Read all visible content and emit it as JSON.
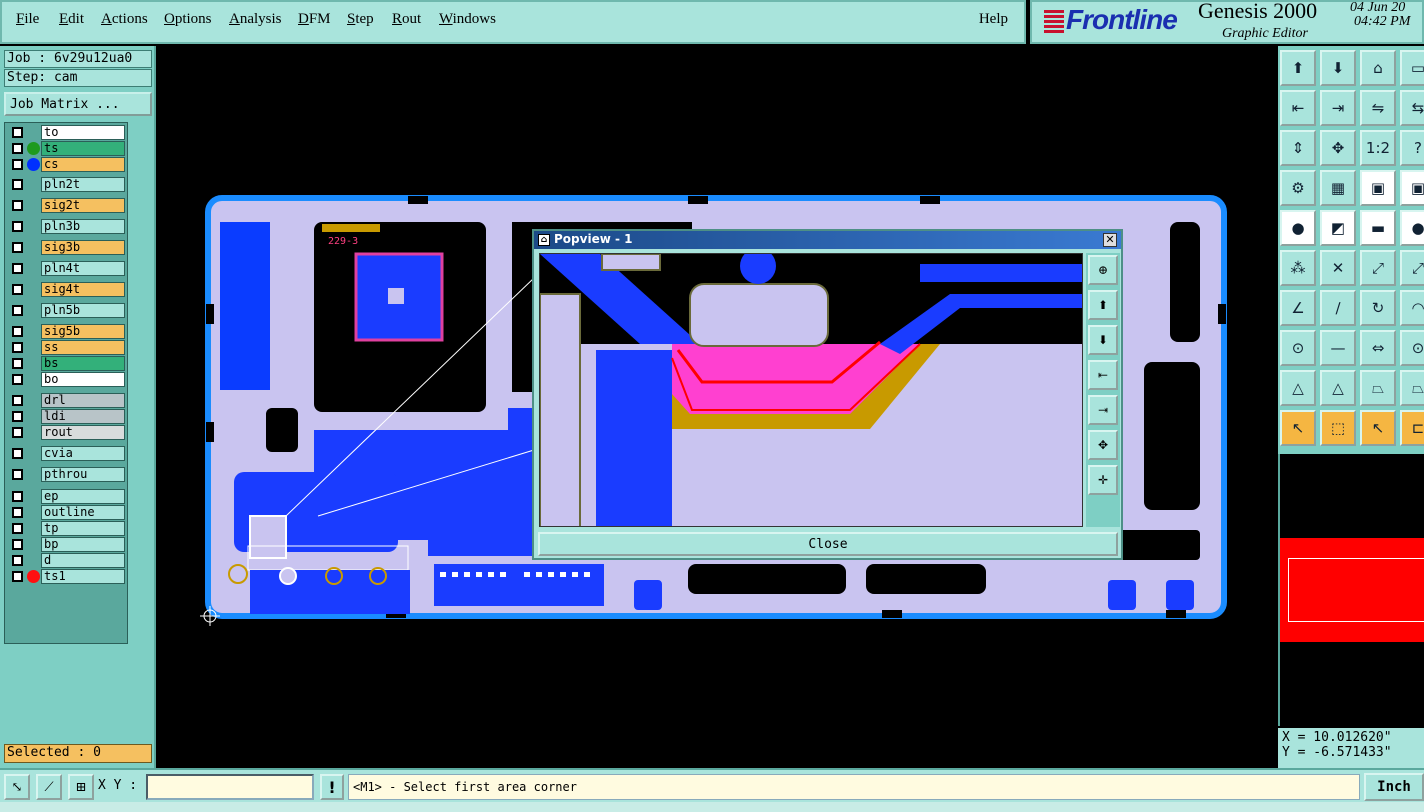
{
  "menu": {
    "items": [
      "File",
      "Edit",
      "Actions",
      "Options",
      "Analysis",
      "DFM",
      "Step",
      "Rout",
      "Windows"
    ],
    "help": "Help"
  },
  "brand": {
    "logo": "Frontline",
    "product": "Genesis 2000",
    "editor": "Graphic Editor",
    "date": "04 Jun 20",
    "time": "04:42 PM"
  },
  "job": {
    "job_label": "Job : 6v29u12ua0",
    "step_label": "Step: cam",
    "matrix_button": "Job Matrix ..."
  },
  "layers": [
    {
      "name": "to",
      "color": "#ffffff",
      "dot": null
    },
    {
      "name": "ts",
      "color": "#33b07a",
      "dot": "#1e9a1e"
    },
    {
      "name": "cs",
      "color": "#f5c060",
      "dot": "#0030ff"
    },
    {
      "name": "pln2t",
      "color": "#a9e4dc",
      "dot": null
    },
    {
      "name": "sig2t",
      "color": "#f5c060",
      "dot": null
    },
    {
      "name": "pln3b",
      "color": "#a9e4dc",
      "dot": null
    },
    {
      "name": "sig3b",
      "color": "#f5c060",
      "dot": null
    },
    {
      "name": "pln4t",
      "color": "#a9e4dc",
      "dot": null
    },
    {
      "name": "sig4t",
      "color": "#f5c060",
      "dot": null
    },
    {
      "name": "pln5b",
      "color": "#a9e4dc",
      "dot": null
    },
    {
      "name": "sig5b",
      "color": "#f5c060",
      "dot": null
    },
    {
      "name": "ss",
      "color": "#f5c060",
      "dot": null
    },
    {
      "name": "bs",
      "color": "#33b07a",
      "dot": null
    },
    {
      "name": "bo",
      "color": "#ffffff",
      "dot": null
    },
    {
      "name": "drl",
      "color": "#b8c4c8",
      "dot": null
    },
    {
      "name": "ldi",
      "color": "#b8c4c8",
      "dot": null
    },
    {
      "name": "rout",
      "color": "#d8dcdc",
      "dot": null
    },
    {
      "name": "cvia",
      "color": "#a9e4dc",
      "dot": null
    },
    {
      "name": "pthrou",
      "color": "#a9e4dc",
      "dot": null
    },
    {
      "name": "ep",
      "color": "#a9e4dc",
      "dot": null
    },
    {
      "name": "outline",
      "color": "#a9e4dc",
      "dot": null
    },
    {
      "name": "tp",
      "color": "#a9e4dc",
      "dot": null
    },
    {
      "name": "bp",
      "color": "#a9e4dc",
      "dot": null
    },
    {
      "name": "d",
      "color": "#a9e4dc",
      "dot": null
    },
    {
      "name": "ts1",
      "color": "#a9e4dc",
      "dot": "#ff1010"
    }
  ],
  "selected": "Selected : 0",
  "toolbar_icons": [
    "zoom-home-icon",
    "zoom-in-icon",
    "home-icon",
    "panel-icon",
    "pan-left-icon",
    "pan-right-icon",
    "mirror-icon",
    "snap-icon",
    "fit-vertical-icon",
    "fit-all-icon",
    "scale-icon",
    "help-icon",
    "measure-icon",
    "grid-icon",
    "layers-icon",
    "layers-alt-icon",
    "pad-icon",
    "line-icon",
    "ruler-icon",
    "circle-icon",
    "net-icon",
    "cross-icon",
    "snap-point-icon",
    "snap-alt-icon",
    "angle-icon",
    "diagonal-icon",
    "arc-icon",
    "arc-alt-icon",
    "select-pad-icon",
    "select-line-icon",
    "distance-icon",
    "select-alt-icon",
    "triangle-icon",
    "triangle-alt-icon",
    "trapezoid-icon",
    "trapezoid-alt-icon",
    "pointer-icon",
    "pointer-box-icon",
    "pointer-arrow-icon",
    "pointer-alt-icon"
  ],
  "coords": {
    "x": "X = 10.012620\"",
    "y": "Y = -6.571433\""
  },
  "popview": {
    "title": "Popview - 1",
    "close_button": "Close"
  },
  "status": {
    "xy_label": "X Y :",
    "xy_value": "",
    "warn": "!",
    "prompt": "<M1> - Select first area corner",
    "unit": "Inch"
  },
  "board_text": "229-3"
}
